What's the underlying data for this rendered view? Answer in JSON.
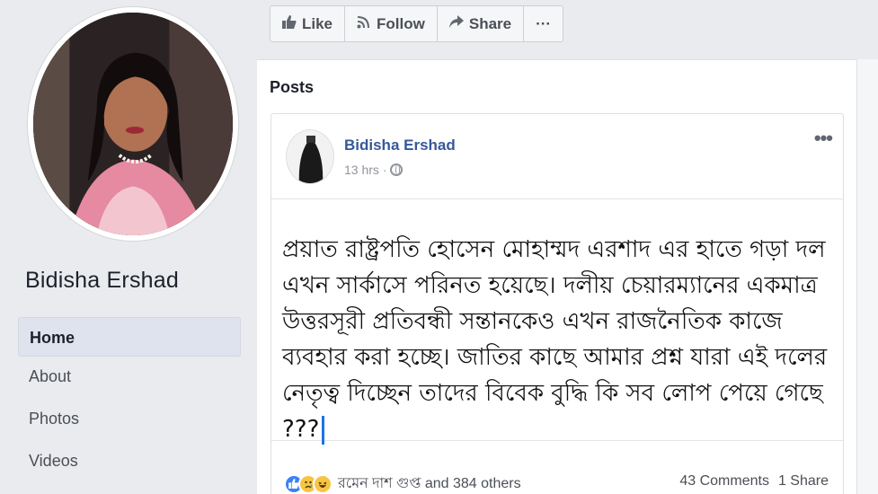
{
  "sidebar": {
    "page_name": "Bidisha Ershad",
    "nav": [
      {
        "label": "Home",
        "active": true
      },
      {
        "label": "About"
      },
      {
        "label": "Photos"
      },
      {
        "label": "Videos"
      }
    ]
  },
  "actions": {
    "like": "Like",
    "follow": "Follow",
    "share": "Share",
    "more": "···"
  },
  "posts": {
    "section_title": "Posts",
    "post": {
      "author": "Bidisha Ershad",
      "time": "13 hrs · ",
      "more": "•••",
      "text": "প্রয়াত রাষ্ট্রপতি হোসেন মোহাম্মদ এরশাদ এর  হাতে গড়া দল এখন সার্কাসে পরিনত হয়েছে। দলীয় চেয়ারম্যানের একমাত্র উত্তরসূরী প্রতিবন্ধী সন্তানকেও এখন রাজনৈতিক কাজে ব্যবহার করা হচ্ছে।  জাতির কাছে আমার প্রশ্ন যারা এই দলের নেতৃত্ব দিচ্ছেন তাদের বিবেক বুদ্ধি কি সব লোপ পেয়ে গেছে ???",
      "reactions_text": "রমেন দাশ গুপ্ত and 384 others",
      "comments": "43 Comments",
      "shares": "1 Share"
    }
  },
  "icons": {
    "like_icon": "thumbs-up",
    "follow_icon": "rss",
    "share_icon": "arrow-share",
    "privacy_icon": "globe"
  },
  "colors": {
    "link_blue": "#365899",
    "background": "#e9ebee",
    "like_reaction": "#3b82f6",
    "emoji_yellow": "#f7c544"
  }
}
